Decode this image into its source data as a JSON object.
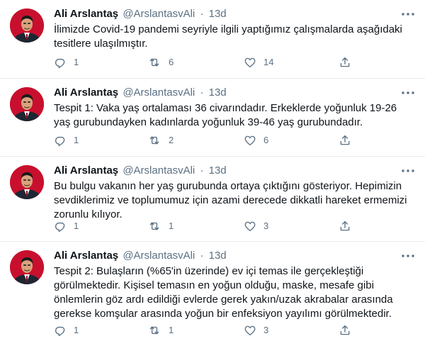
{
  "tweets": [
    {
      "name": "Ali Arslantaş",
      "handle": "@ArslantasvAli",
      "separator": "·",
      "time": "13d",
      "text": "İlimizde Covid-19 pandemi seyriyle ilgili yaptığımız çalışmalarda aşağıdaki tesitlere ulaşılmıştır.",
      "replies": "1",
      "retweets": "6",
      "likes": "14"
    },
    {
      "name": "Ali Arslantaş",
      "handle": "@ArslantasvAli",
      "separator": "·",
      "time": "13d",
      "text": "Tespit 1: Vaka yaş ortalaması 36 civarındadır. Erkeklerde yoğunluk 19-26 yaş gurubundayken kadınlarda yoğunluk 39-46 yaş gurubundadır.",
      "replies": "1",
      "retweets": "2",
      "likes": "6"
    },
    {
      "name": "Ali Arslantaş",
      "handle": "@ArslantasvAli",
      "separator": "·",
      "time": "13d",
      "text": "Bu bulgu vakanın her yaş gurubunda ortaya çıktığını gösteriyor. Hepimizin sevdiklerimiz ve toplumumuz için azami derecede dikkatli hareket ermemizi zorunlu kılıyor.",
      "replies": "1",
      "retweets": "1",
      "likes": "3"
    },
    {
      "name": "Ali Arslantaş",
      "handle": "@ArslantasvAli",
      "separator": "·",
      "time": "13d",
      "text": "Tespit 2: Bulaşların (%65'in üzerinde) ev içi temas ile gerçekleştiği görülmektedir. Kişisel temasın en yoğun olduğu, maske, mesafe gibi önlemlerin göz ardı edildiği evlerde gerek yakın/uzak akrabalar arasında gerekse komşular arasında yoğun bir enfeksiyon yayılımı görülmektedir.",
      "replies": "1",
      "retweets": "1",
      "likes": "3"
    }
  ],
  "icons": {
    "avatar": "profile-photo",
    "more": "more-icon",
    "reply": "reply-icon",
    "retweet": "retweet-icon",
    "like": "like-icon",
    "share": "share-icon"
  },
  "colors": {
    "text": "#0f1419",
    "secondary": "#5b7083",
    "divider": "#e6ecf0",
    "avatar_bg": "#c8102e"
  }
}
